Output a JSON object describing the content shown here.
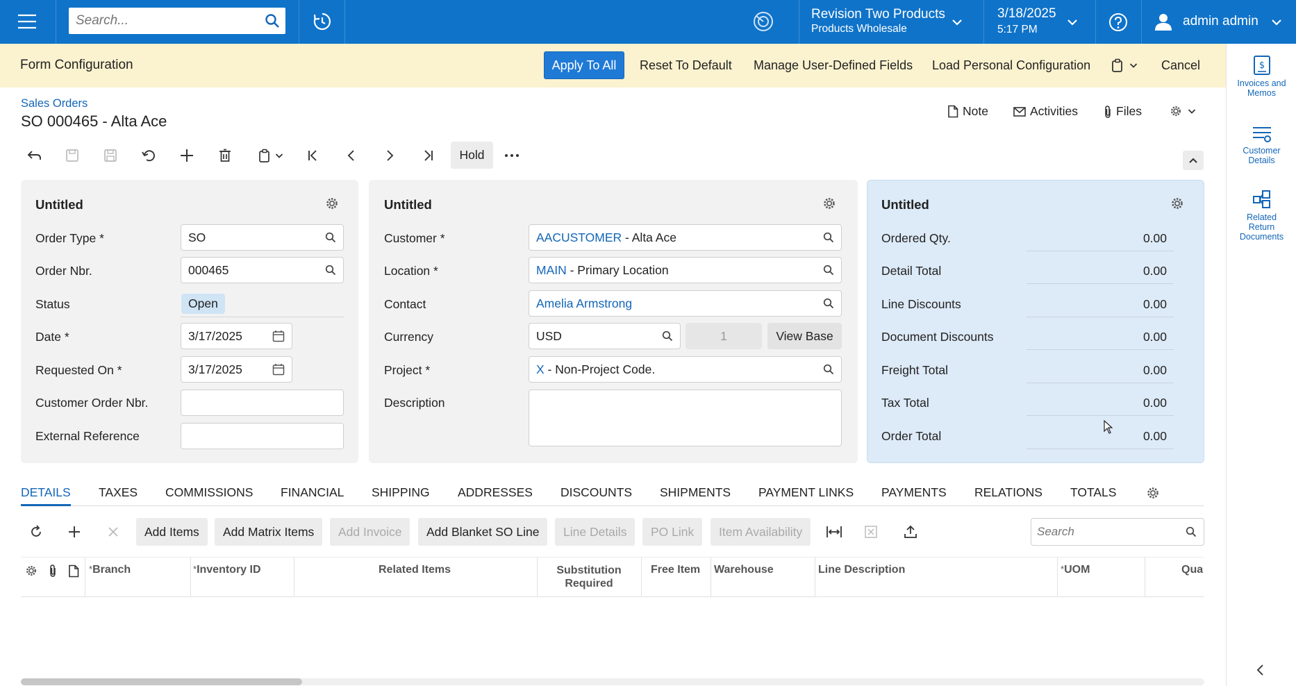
{
  "topbar": {
    "search_placeholder": "Search...",
    "company_name": "Revision Two Products",
    "company_sub": "Products Wholesale",
    "date": "3/18/2025",
    "time": "5:17 PM",
    "user": "admin admin",
    "bg_color": "#0f73c9"
  },
  "config_bar": {
    "title": "Form Configuration",
    "apply_all": "Apply To All",
    "reset_default": "Reset To Default",
    "manage_udf": "Manage User-Defined Fields",
    "load_personal": "Load Personal Configuration",
    "cancel": "Cancel"
  },
  "rail": {
    "invoices_memos": "Invoices and Memos",
    "customer_details": "Customer Details",
    "related_return": "Related Return Documents"
  },
  "header": {
    "breadcrumb": "Sales Orders",
    "title": "SO 000465 - Alta Ace",
    "note": "Note",
    "activities": "Activities",
    "files": "Files",
    "hold": "Hold"
  },
  "panel1": {
    "title": "Untitled",
    "order_type_label": "Order Type *",
    "order_type": "SO",
    "order_nbr_label": "Order Nbr.",
    "order_nbr": "000465",
    "status_label": "Status",
    "status": "Open",
    "date_label": "Date *",
    "date": "3/17/2025",
    "requested_on_label": "Requested On *",
    "requested_on": "3/17/2025",
    "customer_order_nbr_label": "Customer Order Nbr.",
    "customer_order_nbr": "",
    "external_ref_label": "External Reference",
    "external_ref": ""
  },
  "panel2": {
    "title": "Untitled",
    "customer_label": "Customer *",
    "customer_code": "AACUSTOMER",
    "customer_name": " - Alta Ace",
    "location_label": "Location *",
    "location_code": "MAIN",
    "location_name": " - Primary Location",
    "contact_label": "Contact",
    "contact": "Amelia Armstrong",
    "currency_label": "Currency",
    "currency": "USD",
    "currency_rate": "1",
    "view_base": "View Base",
    "project_label": "Project *",
    "project_code": "X",
    "project_name": " - Non-Project Code.",
    "description_label": "Description",
    "description": ""
  },
  "panel3": {
    "title": "Untitled",
    "rows": [
      {
        "label": "Ordered Qty.",
        "value": "0.00"
      },
      {
        "label": "Detail Total",
        "value": "0.00"
      },
      {
        "label": "Line Discounts",
        "value": "0.00"
      },
      {
        "label": "Document Discounts",
        "value": "0.00"
      },
      {
        "label": "Freight Total",
        "value": "0.00"
      },
      {
        "label": "Tax Total",
        "value": "0.00"
      },
      {
        "label": "Order Total",
        "value": "0.00"
      }
    ]
  },
  "tabs": [
    "DETAILS",
    "TAXES",
    "COMMISSIONS",
    "FINANCIAL",
    "SHIPPING",
    "ADDRESSES",
    "DISCOUNTS",
    "SHIPMENTS",
    "PAYMENT LINKS",
    "PAYMENTS",
    "RELATIONS",
    "TOTALS"
  ],
  "grid_toolbar": {
    "add_items": "Add Items",
    "add_matrix": "Add Matrix Items",
    "add_invoice": "Add Invoice",
    "add_blanket": "Add Blanket SO Line",
    "line_details": "Line Details",
    "po_link": "PO Link",
    "item_availability": "Item Availability",
    "search_placeholder": "Search"
  },
  "grid_columns": {
    "branch": "Branch",
    "inventory_id": "Inventory ID",
    "related_items": "Related Items",
    "substitution_1": "Substitution",
    "substitution_2": "Required",
    "free_item": "Free Item",
    "warehouse": "Warehouse",
    "line_description": "Line Description",
    "uom": "UOM",
    "qty": "Qua",
    "required_mark": "*"
  }
}
